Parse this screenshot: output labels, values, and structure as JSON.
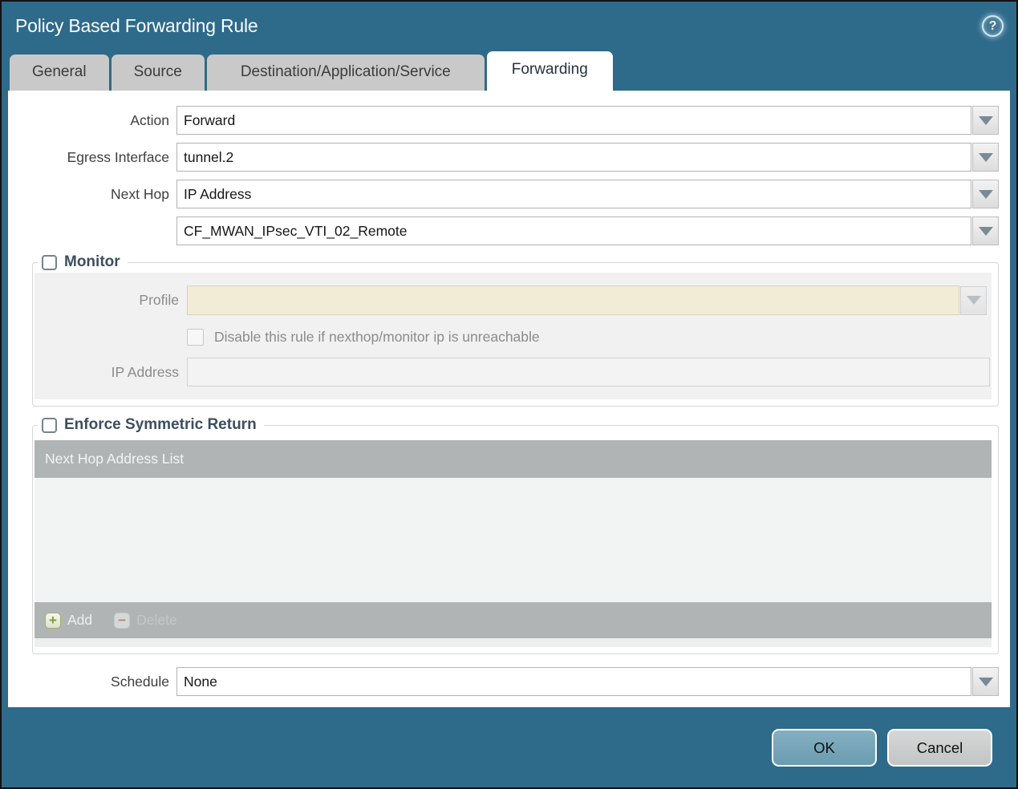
{
  "window": {
    "title": "Policy Based Forwarding Rule",
    "help_glyph": "?"
  },
  "tabs": [
    {
      "label": "General",
      "active": false
    },
    {
      "label": "Source",
      "active": false
    },
    {
      "label": "Destination/Application/Service",
      "active": false
    },
    {
      "label": "Forwarding",
      "active": true
    }
  ],
  "form": {
    "action": {
      "label": "Action",
      "value": "Forward"
    },
    "egress_interface": {
      "label": "Egress Interface",
      "value": "tunnel.2"
    },
    "next_hop": {
      "label": "Next Hop",
      "value": "IP Address"
    },
    "next_hop_address": {
      "value": "CF_MWAN_IPsec_VTI_02_Remote"
    },
    "schedule": {
      "label": "Schedule",
      "value": "None"
    }
  },
  "monitor": {
    "title": "Monitor",
    "checked": false,
    "profile": {
      "label": "Profile",
      "value": ""
    },
    "disable_rule": {
      "label": "Disable this rule if nexthop/monitor ip is unreachable",
      "checked": false
    },
    "ip_address": {
      "label": "IP Address",
      "value": ""
    }
  },
  "enforce_symmetric_return": {
    "title": "Enforce Symmetric Return",
    "checked": false,
    "table": {
      "header": "Next Hop Address List",
      "rows": []
    },
    "toolbar": {
      "add_label": "Add",
      "delete_label": "Delete"
    }
  },
  "footer": {
    "ok_label": "OK",
    "cancel_label": "Cancel"
  },
  "colors": {
    "titlebar_teal": "#2e6a89",
    "tab_gray": "#c9c9c9",
    "table_header_gray": "#b0b4b4",
    "disabled_input_beige": "#f2ecd7",
    "ok_button_blue": "#73a4b8",
    "cancel_button_gray": "#c9cccc"
  }
}
